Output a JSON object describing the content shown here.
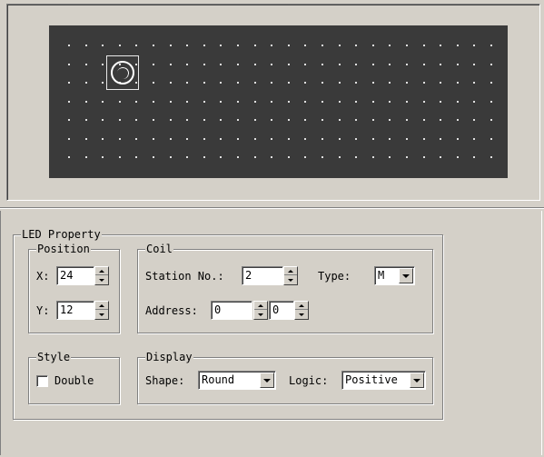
{
  "led_property": {
    "title": "LED Property",
    "position": {
      "title": "Position",
      "x_label": "X:",
      "x_value": "24",
      "y_label": "Y:",
      "y_value": "12"
    },
    "coil": {
      "title": "Coil",
      "station_label": "Station No.:",
      "station_value": "2",
      "type_label": "Type:",
      "type_value": "M",
      "address_label": "Address:",
      "address_value": "0",
      "address_bit_value": "0"
    },
    "style": {
      "title": "Style",
      "double_label": "Double",
      "double_checked": false
    },
    "display": {
      "title": "Display",
      "shape_label": "Shape:",
      "shape_value": "Round",
      "logic_label": "Logic:",
      "logic_value": "Positive"
    }
  },
  "icons": [
    "led-round-icon",
    "spin-up-icon",
    "spin-down-icon",
    "dropdown-arrow-icon"
  ],
  "colors": {
    "canvas_bg": "#3a3a3a",
    "grid_dot": "#e0e0e0",
    "dialog_bg": "#d4d0c8",
    "led_outline": "#ffffff"
  }
}
